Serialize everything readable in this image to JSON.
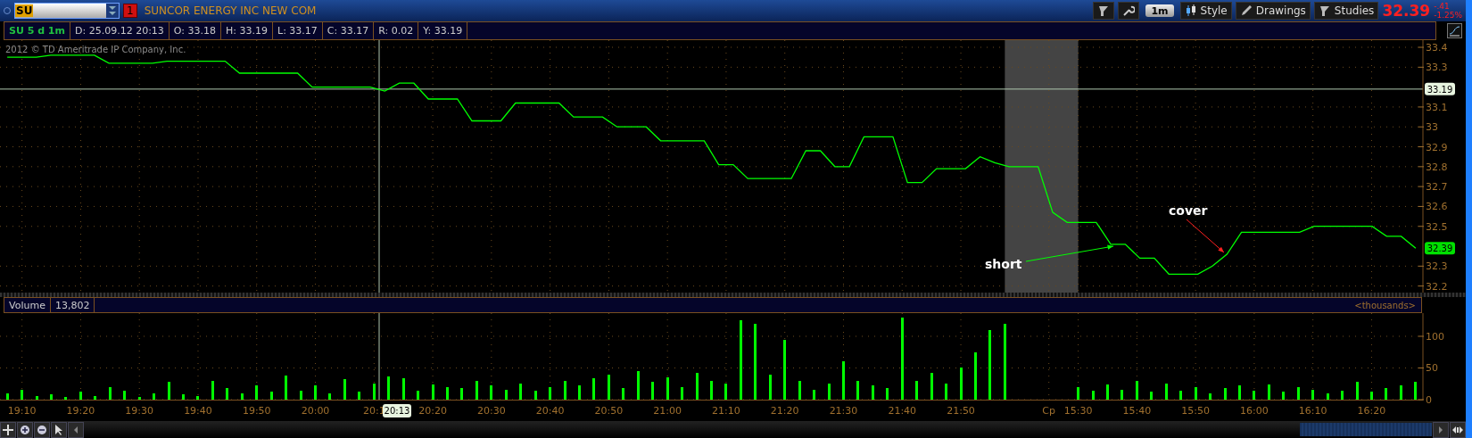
{
  "toolbar": {
    "symbol": "SU",
    "alert_badge": "1",
    "company": "SUNCOR ENERGY INC NEW COM",
    "interval": "1m",
    "buttons": [
      {
        "kind": "style",
        "label": "Style"
      },
      {
        "kind": "drawings",
        "label": "Drawings"
      },
      {
        "kind": "studies",
        "label": "Studies"
      }
    ],
    "last_price": "32.39",
    "change": "-.41",
    "change_percent": "-1.25%"
  },
  "info_bar": {
    "title": "SU 5 d 1m",
    "fields": [
      "D: 25.09.12 20:13",
      "O: 33.18",
      "H: 33.19",
      "L: 33.17",
      "C: 33.17",
      "R: 0.02",
      "Y: 33.19"
    ]
  },
  "price_pane": {
    "copyright": "2012 © TD Ameritrade IP Company, Inc.",
    "last_price_label": "32.39",
    "chart_data": {
      "type": "line",
      "categories": [
        null,
        null,
        null,
        null,
        null,
        null,
        null,
        null,
        null,
        null,
        null,
        null,
        null,
        null,
        null,
        null,
        null,
        null,
        null,
        null,
        null,
        null,
        null,
        null,
        null,
        null,
        null,
        null,
        null,
        null,
        null,
        null,
        null,
        null,
        null,
        null,
        null,
        null,
        null,
        null,
        null,
        null,
        null,
        null,
        null,
        null,
        null,
        null,
        null,
        null,
        null,
        null,
        null,
        null,
        null,
        null,
        null,
        null,
        null,
        null,
        null,
        null,
        null,
        null,
        null,
        null,
        null,
        null,
        null,
        null,
        null,
        null,
        null,
        null,
        null,
        null,
        null,
        null,
        null,
        null,
        null,
        null,
        null,
        null,
        null,
        null,
        null,
        null,
        null,
        null,
        null,
        null,
        null,
        null,
        null,
        null,
        null,
        null
      ],
      "series": [
        {
          "color": "#00ff00",
          "values": [
            33.35,
            33.35,
            33.35,
            33.36,
            33.36,
            33.36,
            33.36,
            33.32,
            33.32,
            33.32,
            33.32,
            33.33,
            33.33,
            33.33,
            33.33,
            33.33,
            33.27,
            33.27,
            33.27,
            33.27,
            33.27,
            33.2,
            33.2,
            33.2,
            33.2,
            33.2,
            33.18,
            33.22,
            33.22,
            33.14,
            33.14,
            33.14,
            33.03,
            33.03,
            33.03,
            33.12,
            33.12,
            33.12,
            33.12,
            33.05,
            33.05,
            33.05,
            33.0,
            33.0,
            33.0,
            32.93,
            32.93,
            32.93,
            32.93,
            32.81,
            32.81,
            32.74,
            32.74,
            32.74,
            32.74,
            32.88,
            32.88,
            32.8,
            32.8,
            32.95,
            32.95,
            32.95,
            32.72,
            32.72,
            32.79,
            32.79,
            32.79,
            32.85,
            32.82,
            32.8,
            32.8,
            32.8,
            32.57,
            32.52,
            32.52,
            32.52,
            32.41,
            32.41,
            32.34,
            32.34,
            32.26,
            32.26,
            32.26,
            32.3,
            32.36,
            32.47,
            32.47,
            32.47,
            32.47,
            32.47,
            32.5,
            32.5,
            32.5,
            32.5,
            32.5,
            32.45,
            32.45,
            32.39
          ]
        }
      ],
      "ylim": [
        32.167,
        33.436
      ],
      "grid": true,
      "yticks": [
        {
          "value": 32.2,
          "label": "32.2"
        },
        {
          "value": 32.3,
          "label": "32.3"
        },
        {
          "value": 32.5,
          "label": "32.5"
        },
        {
          "value": 32.6,
          "label": "32.6"
        },
        {
          "value": 32.7,
          "label": "32.7"
        },
        {
          "value": 32.8,
          "label": "32.8"
        },
        {
          "value": 32.9,
          "label": "32.9"
        },
        {
          "value": 33,
          "label": "33"
        },
        {
          "value": 33.1,
          "label": "33.1"
        },
        {
          "value": 33.3,
          "label": "33.3"
        },
        {
          "value": 33.4,
          "label": "33.4"
        }
      ],
      "ref_lines": [
        {
          "axis": "y",
          "value": 33.19,
          "label": "33.19"
        }
      ],
      "annotations": [
        "short",
        "cover"
      ]
    }
  },
  "volume_pane": {
    "label": "Volume",
    "total": "13,802",
    "units": "<thousands>",
    "crosshair_time_label": "20:13",
    "chart_data": {
      "type": "bar",
      "categories": [
        null,
        "19:10",
        null,
        null,
        null,
        "19:20",
        null,
        null,
        null,
        "19:30",
        null,
        null,
        null,
        "19:40",
        null,
        null,
        null,
        "19:50",
        null,
        null,
        null,
        "20:00",
        null,
        null,
        null,
        "20:1",
        null,
        null,
        null,
        "20:20",
        null,
        null,
        null,
        "20:30",
        null,
        null,
        null,
        "20:40",
        null,
        null,
        null,
        "20:50",
        null,
        null,
        null,
        "21:00",
        null,
        null,
        null,
        "21:10",
        null,
        null,
        null,
        "21:20",
        null,
        null,
        null,
        "21:30",
        null,
        null,
        null,
        "21:40",
        null,
        null,
        null,
        "21:50",
        null,
        null,
        null,
        null,
        null,
        "Cp",
        null,
        "15:30",
        null,
        null,
        null,
        "15:40",
        null,
        null,
        null,
        "15:50",
        null,
        null,
        null,
        "16:00",
        null,
        null,
        null,
        "16:10",
        null,
        null,
        null,
        "16:20",
        null,
        null,
        null
      ],
      "values": [
        10,
        15,
        5,
        8,
        4,
        12,
        6,
        20,
        14,
        4,
        10,
        28,
        8,
        5,
        30,
        18,
        10,
        22,
        12,
        38,
        14,
        22,
        10,
        32,
        12,
        26,
        36,
        34,
        14,
        24,
        20,
        18,
        30,
        22,
        16,
        26,
        14,
        20,
        30,
        22,
        34,
        40,
        18,
        45,
        28,
        35,
        20,
        42,
        30,
        25,
        125,
        120,
        40,
        95,
        30,
        16,
        25,
        60,
        30,
        22,
        18,
        130,
        30,
        42,
        26,
        50,
        75,
        110,
        120,
        null,
        null,
        null,
        null,
        20,
        14,
        24,
        16,
        30,
        12,
        26,
        14,
        20,
        10,
        18,
        22,
        14,
        24,
        12,
        20,
        16,
        10,
        14,
        28,
        12,
        18,
        22,
        28
      ],
      "ylim": [
        0,
        136.6
      ],
      "grid": true,
      "yticks": [
        0,
        50,
        100
      ]
    }
  }
}
